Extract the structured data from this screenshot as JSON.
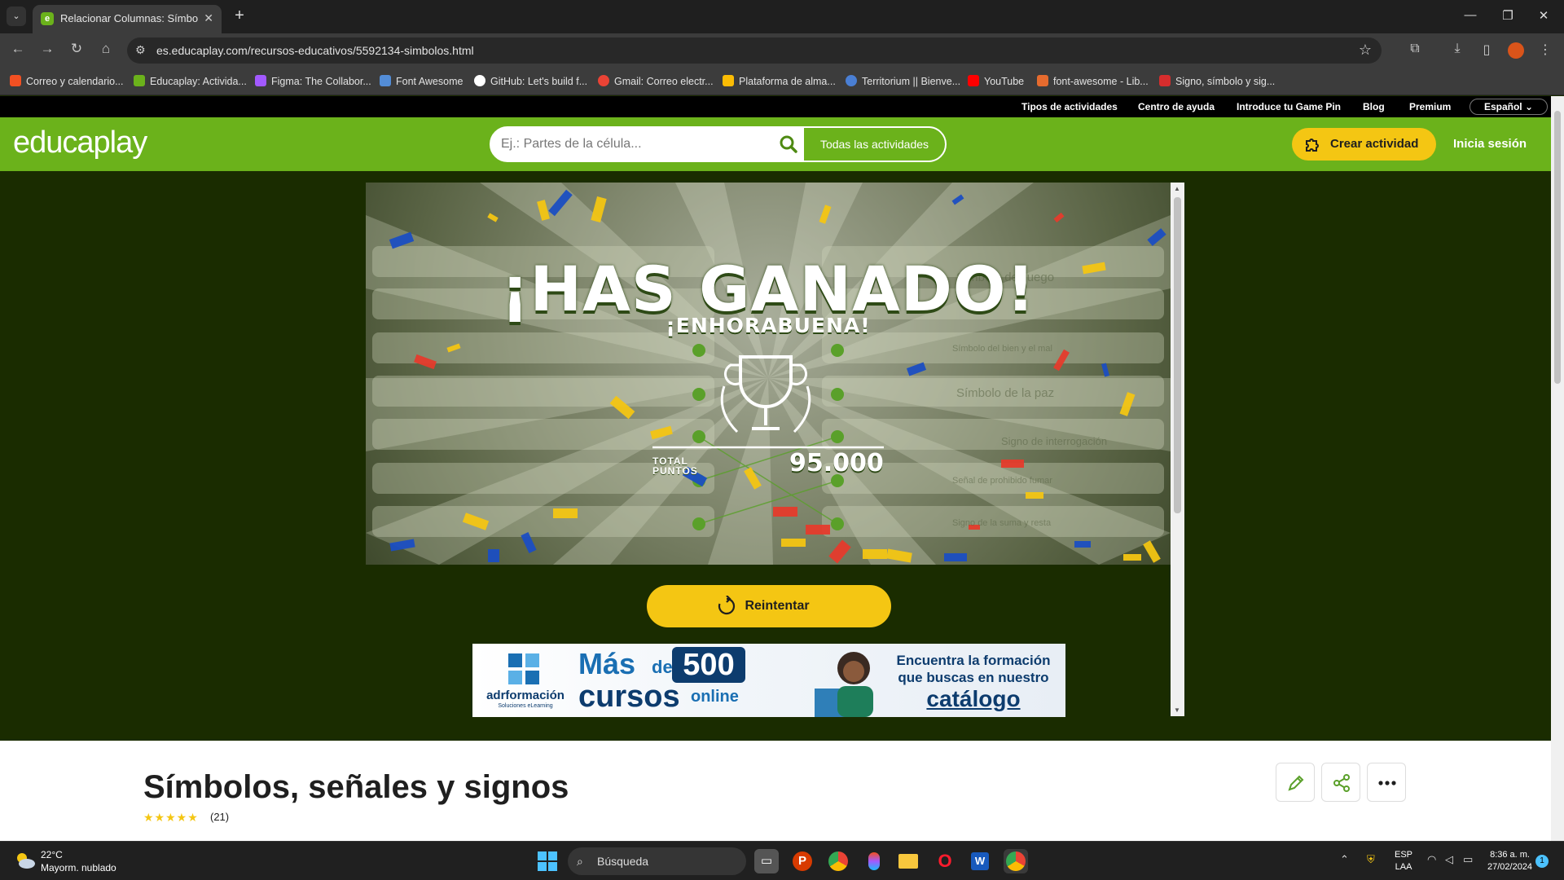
{
  "browser": {
    "tab_title": "Relacionar Columnas: Símbolos",
    "url": "es.educaplay.com/recursos-educativos/5592134-simbolos.html"
  },
  "bookmarks": [
    {
      "label": "Correo y calendario...",
      "color": "#f25022"
    },
    {
      "label": "Educaplay: Activida...",
      "color": "#6bb21b"
    },
    {
      "label": "Figma: The Collabor...",
      "color": "#a259ff"
    },
    {
      "label": "Font Awesome",
      "color": "#538dd7"
    },
    {
      "label": "GitHub: Let's build f...",
      "color": "#ffffff"
    },
    {
      "label": "Gmail: Correo electr...",
      "color": "#ea4335"
    },
    {
      "label": "Plataforma de alma...",
      "color": "#fbbc04"
    },
    {
      "label": "Territorium || Bienve...",
      "color": "#4a7fd4"
    },
    {
      "label": "YouTube",
      "color": "#ff0000"
    },
    {
      "label": "font-awesome - Lib...",
      "color": "#e66b2e"
    },
    {
      "label": "Signo, símbolo y sig...",
      "color": "#d62d2d"
    }
  ],
  "toplinks": [
    "Tipos de actividades",
    "Centro de ayuda",
    "Introduce tu Game Pin",
    "Blog",
    "Premium"
  ],
  "language": "Español",
  "header": {
    "logo": "educaplay",
    "search_placeholder": "Ej.: Partes de la célula...",
    "all_activities": "Todas las actividades",
    "create_activity": "Crear actividad",
    "login": "Inicia sesión"
  },
  "game": {
    "headline": "¡HAS GANADO!",
    "subheadline": "¡ENHORABUENA!",
    "total_label_1": "TOTAL",
    "total_label_2": "PUNTOS",
    "points": "95.000",
    "background_labels": [
      "Símbolo del juego",
      "Símbolo del bien y el mal",
      "Símbolo de la paz",
      "Signo de interrogación",
      "Señal de prohibido fumar",
      "Signo de la suma y resta"
    ],
    "retry": "Reintentar"
  },
  "ad": {
    "brand": "adrformación",
    "brand_sub": "Soluciones eLearning",
    "mas": "Más",
    "de": "de",
    "number": "500",
    "cursos": "cursos",
    "online": "online",
    "tagline": "Encuentra la formación que buscas en nuestro",
    "catalogo": "catálogo"
  },
  "activity": {
    "title": "Símbolos, señales y signos",
    "stars": "★★★★★",
    "rating_count": "(21)"
  },
  "taskbar": {
    "temperature": "22°C",
    "weather": "Mayorm. nublado",
    "search": "Búsqueda",
    "lang_1": "ESP",
    "lang_2": "LAA",
    "time": "8:36 a. m.",
    "date": "27/02/2024",
    "notifications": "1"
  },
  "colors": {
    "brand_green": "#6bb21b",
    "yellow": "#f4c613",
    "dark_bg": "#1a2c00"
  }
}
